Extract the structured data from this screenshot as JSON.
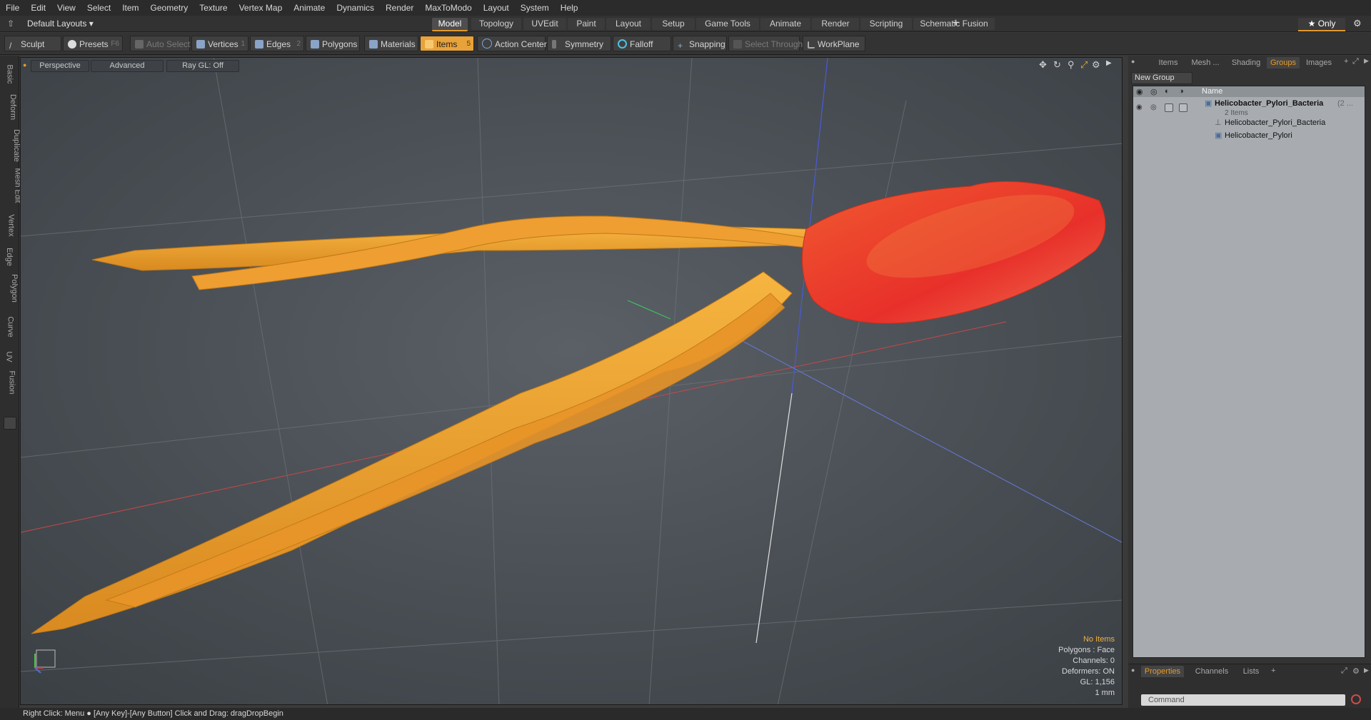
{
  "menu": [
    "File",
    "Edit",
    "View",
    "Select",
    "Item",
    "Geometry",
    "Texture",
    "Vertex Map",
    "Animate",
    "Dynamics",
    "Render",
    "MaxToModo",
    "Layout",
    "System",
    "Help"
  ],
  "layout_selector": "Default Layouts ▾",
  "layout_tabs": [
    "Model",
    "Topology",
    "UVEdit",
    "Paint",
    "Layout",
    "Setup",
    "Game Tools",
    "Animate",
    "Render",
    "Scripting",
    "Schematic Fusion"
  ],
  "active_layout_tab": "Model",
  "only_label": "★ Only",
  "toolbar": {
    "sculpt": "Sculpt",
    "presets": "Presets",
    "presets_key": "F6",
    "auto_select": "Auto Select",
    "vertices": "Vertices",
    "vertices_key": "1",
    "edges": "Edges",
    "edges_key": "2",
    "polygons": "Polygons",
    "materials": "Materials",
    "items": "Items",
    "items_key": "5",
    "action_center": "Action Center",
    "symmetry": "Symmetry",
    "falloff": "Falloff",
    "snapping": "Snapping",
    "select_through": "Select Through",
    "workplane": "WorkPlane"
  },
  "left_tabs": [
    "Basic",
    "Deform",
    "Duplicate",
    "Mesh Edit",
    "Vertex",
    "Edge",
    "Polygon",
    "Curve",
    "UV",
    "Fusion"
  ],
  "viewport": {
    "view": "Perspective",
    "shading": "Advanced",
    "raygl": "Ray GL: Off",
    "info": {
      "selection": "No Items",
      "polygons": "Polygons : Face",
      "channels": "Channels: 0",
      "deformers": "Deformers: ON",
      "gl": "GL: 1,156",
      "unit": "1 mm"
    },
    "colors": {
      "head_red": "#e8402a",
      "body_orange": "#f0a030"
    }
  },
  "right_panel": {
    "tabs": [
      "Items",
      "Mesh ...",
      "Shading",
      "Groups",
      "Images"
    ],
    "active_tab": "Groups",
    "new_group": "New Group",
    "column_name": "Name",
    "items": [
      {
        "name": "Helicobacter_Pylori_Bacteria",
        "suffix": "(2 ...",
        "sub": "2 Items"
      },
      {
        "name": "Helicobacter_Pylori_Bacteria"
      },
      {
        "name": "Helicobacter_Pylori"
      }
    ],
    "bottom_tabs": [
      "Properties",
      "Channels",
      "Lists"
    ],
    "active_bottom_tab": "Properties",
    "command_placeholder": "Command"
  },
  "statusbar": "Right Click: Menu ●  [Any Key]-[Any Button] Click and Drag: dragDropBegin"
}
